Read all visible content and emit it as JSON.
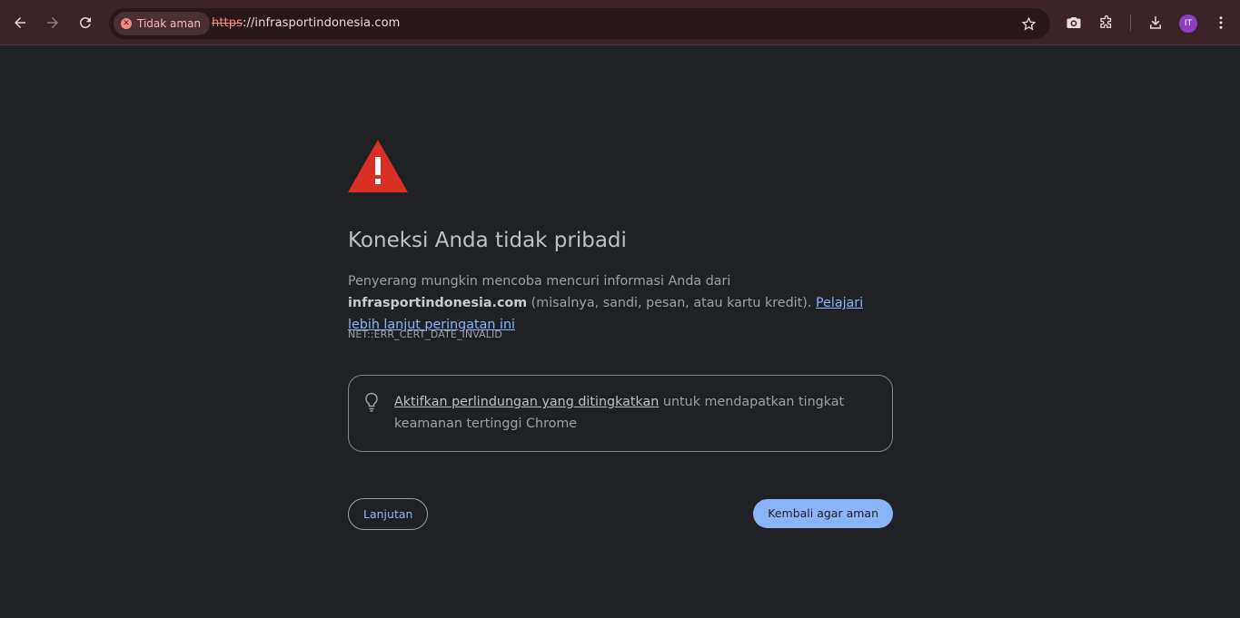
{
  "browser": {
    "security_chip": "Tidak aman",
    "url_scheme": "https",
    "url_rest": "://infrasportindonesia.com",
    "profile_initials": "IT"
  },
  "page": {
    "heading": "Koneksi Anda tidak pribadi",
    "body_prefix": "Penyerang mungkin mencoba mencuri informasi Anda dari ",
    "body_domain": "infrasportindonesia.com",
    "body_suffix": " (misalnya, sandi, pesan, atau kartu kredit). ",
    "learn_more_link": "Pelajari lebih lanjut peringatan ini",
    "error_code": "NET::ERR_CERT_DATE_INVALID",
    "promo_link": "Aktifkan perlindungan yang ditingkatkan",
    "promo_rest": " untuk mendapatkan tingkat keamanan tertinggi Chrome",
    "advanced_button": "Lanjutan",
    "back_button": "Kembali agar aman"
  },
  "colors": {
    "toolbar_bg": "#3c2328",
    "page_bg": "#202124",
    "warning_red": "#d93025",
    "link_blue": "#8ab4f8"
  },
  "icons": [
    "back-arrow-icon",
    "forward-arrow-icon",
    "reload-icon",
    "not-secure-icon",
    "star-icon",
    "camera-icon",
    "extensions-icon",
    "download-icon",
    "more-vert-icon",
    "warning-triangle-icon",
    "lightbulb-icon"
  ]
}
